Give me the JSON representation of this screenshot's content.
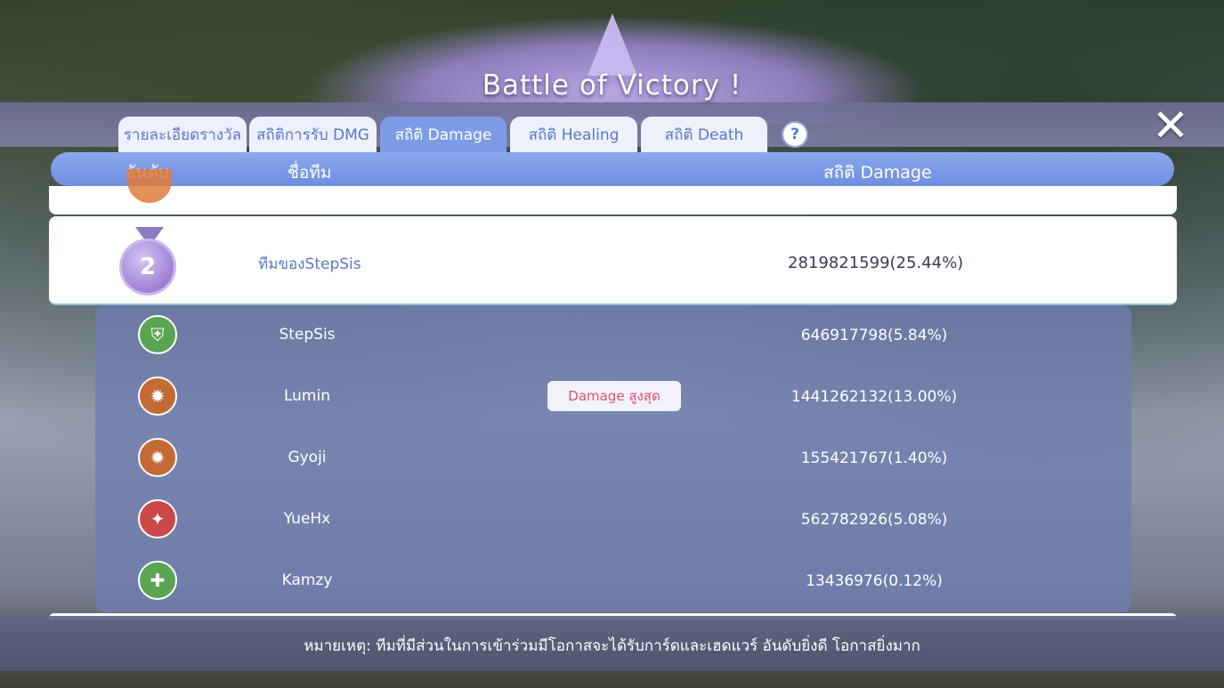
{
  "title": "Battle of Victory !",
  "close_label": "✕",
  "help_label": "?",
  "tabs": [
    {
      "label": "รายละเอียดรางวัล"
    },
    {
      "label": "สถิติการรับ DMG"
    },
    {
      "label": "สถิติ Damage"
    },
    {
      "label": "สถิติ Healing"
    },
    {
      "label": "สถิติ Death"
    }
  ],
  "header": {
    "rank": "อันดับ",
    "team": "ชื่อทีม",
    "stat": "สถิติ Damage"
  },
  "team": {
    "rank": "2",
    "name": "ทีมของStepSis",
    "value": "2819821599(25.44%)"
  },
  "members": [
    {
      "name": "StepSis",
      "value": "646917798(5.84%)",
      "icon": "shield-class-icon",
      "color": "#5aa452"
    },
    {
      "name": "Lumin",
      "value": "1441262132(13.00%)",
      "icon": "flame-class-icon",
      "color": "#c46a35",
      "badge": "Damage สูงสุด"
    },
    {
      "name": "Gyoji",
      "value": "155421767(1.40%)",
      "icon": "flame-class-icon",
      "color": "#c46a35"
    },
    {
      "name": "YueHx",
      "value": "562782926(5.08%)",
      "icon": "blade-class-icon",
      "color": "#c94848"
    },
    {
      "name": "Kamzy",
      "value": "13436976(0.12%)",
      "icon": "cross-class-icon",
      "color": "#5aa452"
    }
  ],
  "note": "หมายเหตุ: ทีมที่มีส่วนในการเข้าร่วมมีโอกาสจะได้รับการ์ดและเฮดแวร์ อันดับยิ่งดี โอกาสยิ่งมาก"
}
